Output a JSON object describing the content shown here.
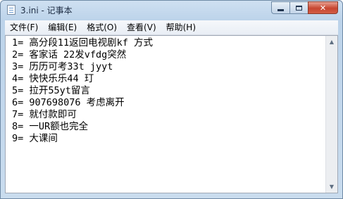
{
  "window": {
    "title": "3.ini - 记事本",
    "close_glyph": "✕"
  },
  "menu": {
    "items": [
      {
        "label": "文件(F)"
      },
      {
        "label": "编辑(E)"
      },
      {
        "label": "格式(O)"
      },
      {
        "label": "查看(V)"
      },
      {
        "label": "帮助(H)"
      }
    ]
  },
  "editor": {
    "lines": [
      "1= 高分段11返回电视剧kf 方式",
      "2= 客家话 22发vfdg突然",
      "3= 历历可考33t jyyt",
      "4= 快快乐乐44 玎",
      "5= 拉开55yt留言",
      "6= 907698076 考虑离开",
      "7= 就付款即可",
      "8= 一UR额也完全",
      "9= 大课间"
    ]
  },
  "scrollbar": {
    "up_glyph": "▲",
    "down_glyph": "▼"
  },
  "icons": {
    "app": "notepad-icon",
    "minimize": "minimize-icon",
    "maximize": "maximize-icon",
    "close": "close-icon"
  }
}
